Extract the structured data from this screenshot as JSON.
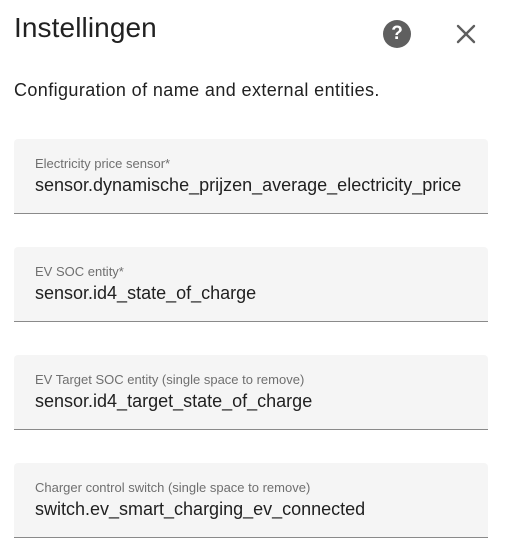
{
  "dialog": {
    "title": "Instellingen",
    "help_icon": "help-circle-icon",
    "close_icon": "close-icon",
    "description": "Configuration of name and external entities."
  },
  "fields": [
    {
      "label": "Electricity price sensor*",
      "value": "sensor.dynamische_prijzen_average_electricity_price"
    },
    {
      "label": "EV SOC entity*",
      "value": "sensor.id4_state_of_charge"
    },
    {
      "label": "EV Target SOC entity (single space to remove)",
      "value": "sensor.id4_target_state_of_charge"
    },
    {
      "label": "Charger control switch (single space to remove)",
      "value": "switch.ev_smart_charging_ev_connected"
    }
  ],
  "colors": {
    "field_background": "#f5f5f5",
    "field_underline": "#8a8a8a",
    "help_icon_background": "#5f5f5f",
    "text_primary": "#212121",
    "text_secondary": "#6f6f6f"
  }
}
